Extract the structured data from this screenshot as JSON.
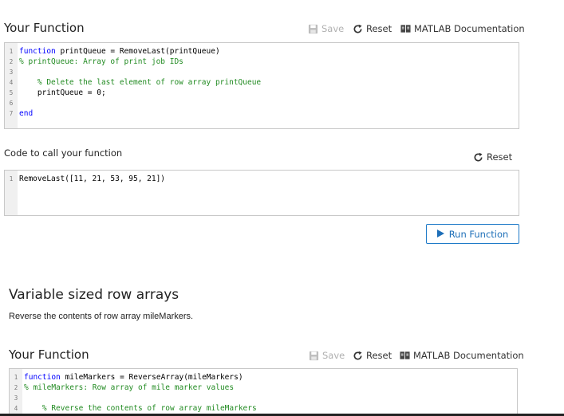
{
  "section1": {
    "title": "Your Function",
    "save_label": "Save",
    "reset_label": "Reset",
    "docs_label": "MATLAB Documentation",
    "code": [
      {
        "n": "1",
        "parts": [
          {
            "c": "kw",
            "t": "function"
          },
          {
            "c": "pl",
            "t": " printQueue = RemoveLast(printQueue)"
          }
        ]
      },
      {
        "n": "2",
        "parts": [
          {
            "c": "cm",
            "t": "% printQueue: Array of print job IDs"
          }
        ]
      },
      {
        "n": "3",
        "parts": []
      },
      {
        "n": "4",
        "parts": [
          {
            "c": "cm",
            "t": "    % Delete the last element of row array printQueue"
          }
        ]
      },
      {
        "n": "5",
        "parts": [
          {
            "c": "pl",
            "t": "    printQueue = 0;"
          }
        ]
      },
      {
        "n": "6",
        "parts": []
      },
      {
        "n": "7",
        "parts": [
          {
            "c": "kw",
            "t": "end"
          }
        ]
      }
    ]
  },
  "call": {
    "title": "Code to call your function",
    "reset_label": "Reset",
    "code": [
      {
        "n": "1",
        "parts": [
          {
            "c": "pl",
            "t": "RemoveLast([11, 21, 53, 95, 21])"
          }
        ]
      }
    ],
    "run_label": "Run Function"
  },
  "section2": {
    "heading": "Variable sized row arrays",
    "description": "Reverse the contents of row array mileMarkers.",
    "title": "Your Function",
    "save_label": "Save",
    "reset_label": "Reset",
    "docs_label": "MATLAB Documentation",
    "code": [
      {
        "n": "1",
        "parts": [
          {
            "c": "kw",
            "t": "function"
          },
          {
            "c": "pl",
            "t": " mileMarkers = ReverseArray(mileMarkers)"
          }
        ]
      },
      {
        "n": "2",
        "parts": [
          {
            "c": "cm",
            "t": "% mileMarkers: Row array of mile marker values"
          }
        ]
      },
      {
        "n": "3",
        "parts": []
      },
      {
        "n": "4",
        "parts": [
          {
            "c": "cm",
            "t": "    % Reverse the contents of row array mileMarkers"
          }
        ]
      }
    ]
  },
  "colors": {
    "keyword": "#0000ff",
    "comment": "#228b22",
    "accent": "#1e7ac8"
  }
}
